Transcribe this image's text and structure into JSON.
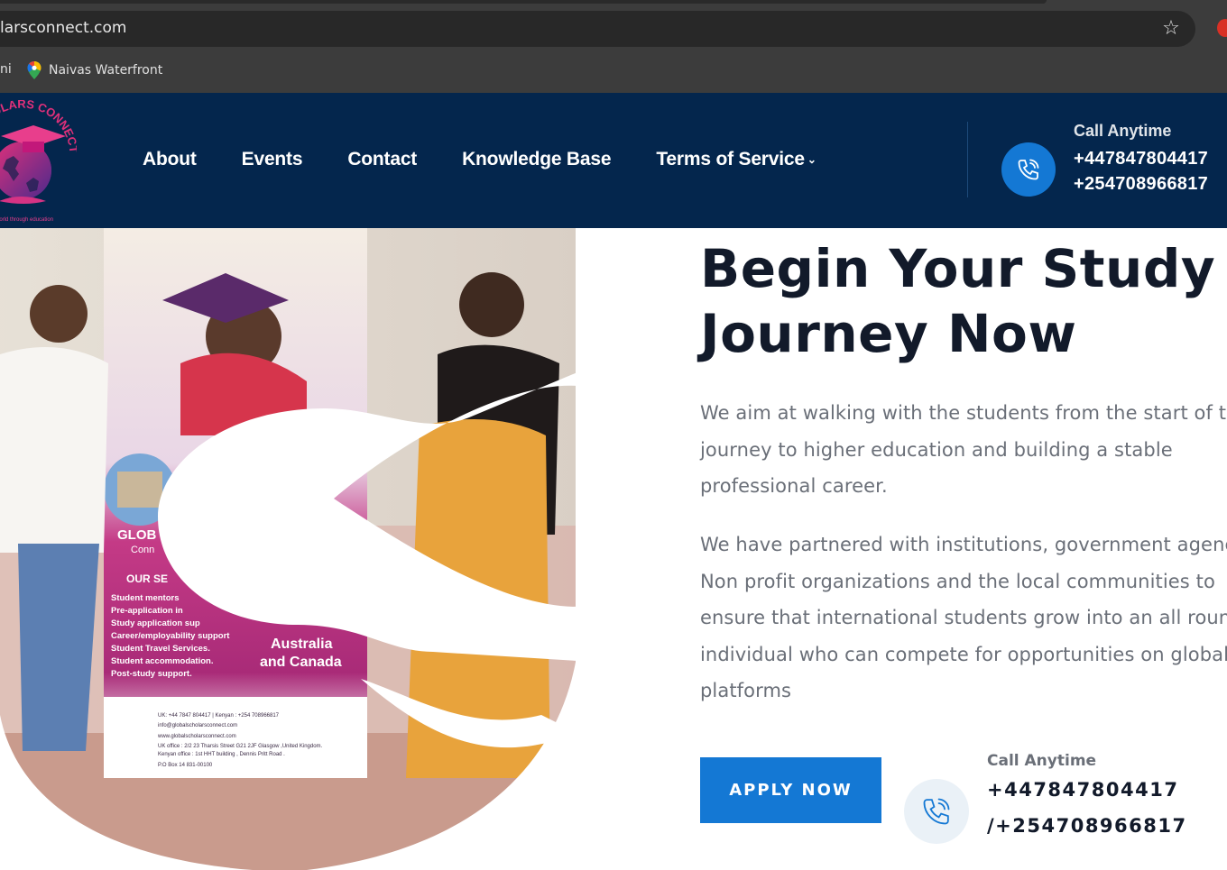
{
  "browser": {
    "url_visible": "larsconnect.com",
    "bookmark_fragment": "ni",
    "bookmark_label": "Naivas Waterfront"
  },
  "site": {
    "logo_text": "SCHOLARS CONNECT",
    "nav": [
      {
        "label": "About"
      },
      {
        "label": "Events"
      },
      {
        "label": "Contact"
      },
      {
        "label": "Knowledge Base"
      },
      {
        "label": "Terms of Service"
      }
    ],
    "header_call": {
      "label": "Call Anytime",
      "phone1": "+447847804417",
      "phone2": "+254708966817"
    }
  },
  "hero": {
    "title_line1": "Begin Your Study",
    "title_line2": "Journey Now",
    "para1_lines": [
      "We aim at walking with the students from the start of their",
      "journey to higher education and building a stable",
      "professional career."
    ],
    "para2_lines": [
      "We have partnered with institutions, government agencies,",
      "Non profit organizations and the local communities to",
      "ensure that international students grow into an all round",
      "individual who can compete for opportunities on global",
      "platforms"
    ],
    "apply_label": "APPLY NOW",
    "bottom_call": {
      "label": "Call Anytime",
      "phone1": "+447847804417",
      "phone2": "/+254708966817"
    },
    "banner_text": {
      "heading_fragment": "GLOB",
      "subheading_fragment": "Conn",
      "services_heading": "OUR SE",
      "services": [
        "Student mentors",
        "Pre-application in",
        "Study application sup",
        "Career/employability support",
        "Student Travel Services.",
        "Student accommodation.",
        "Post-study support."
      ],
      "countries": [
        "Australia",
        "and Canada"
      ],
      "contact_lines": [
        "UK: +44 7847 804417  |  Kenyan : +254 708966817",
        "info@globalscholarsconnect.com",
        "www.globalscholarsconnect.com",
        "UK office : 2/2 23 Tharsis Street G21 2JF Glasgow ,United Kingdom.",
        "Kenyan office : 1st HHT building , Dennis Pritt Road .",
        "P.O Box 14 831-00100"
      ]
    }
  },
  "colors": {
    "header_bg": "#04264d",
    "accent_blue": "#1478d4",
    "title_color": "#121a2a",
    "body_text": "#6a6f78"
  }
}
